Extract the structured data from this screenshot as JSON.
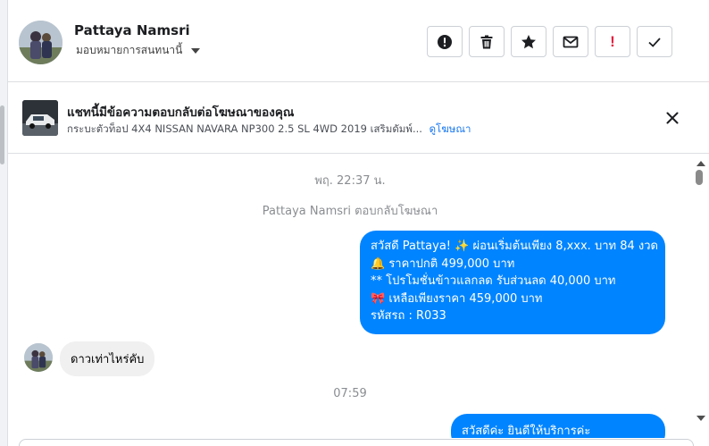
{
  "header": {
    "contact_name": "Pattaya Namsri",
    "assign_label": "มอบหมายการสนทนานี้",
    "actions": [
      {
        "icon": "alert-circle-icon",
        "name": "mark-spam-button"
      },
      {
        "icon": "trash-icon",
        "name": "delete-button"
      },
      {
        "icon": "star-icon",
        "name": "star-button"
      },
      {
        "icon": "envelope-icon",
        "name": "mark-unread-button"
      },
      {
        "icon": "exclamation-icon",
        "name": "follow-up-button",
        "text": "!"
      },
      {
        "icon": "check-icon",
        "name": "mark-done-button"
      }
    ]
  },
  "banner": {
    "title": "แชทนี้มีข้อความตอบกลับต่อโฆษณาของคุณ",
    "subtitle": "กระบะตัวท็อป 4X4 NISSAN NAVARA NP300 2.5 SL 4WD 2019 เสริมดัมพ์...",
    "link": "ดูโฆษณา"
  },
  "conversation": {
    "timestamp_1": "พฤ. 22:37 น.",
    "reply_note": "Pattaya Namsri ตอบกลับโฆษณา",
    "outgoing_1": [
      "สวัสดี Pattaya! ✨  ผ่อนเริ่มต้นเพียง 8,xxx. บาท 84 งวด",
      "🔔 ราคาปกติ 499,000 บาท",
      "** โปรโมชั่นข้าวแลกลด รับส่วนลด 40,000 บาท",
      "🎀  เหลือเพียงราคา 459,000 บาท",
      " รหัสรถ : R033"
    ],
    "incoming_1": "ดาวเท่าไหร่คับ",
    "timestamp_2": "07:59",
    "outgoing_2": "สวัสดีค่ะ ยินดีให้บริการค่ะ"
  },
  "colors": {
    "accent": "#0084ff",
    "link": "#1877f2",
    "alert": "#e41e3f"
  }
}
